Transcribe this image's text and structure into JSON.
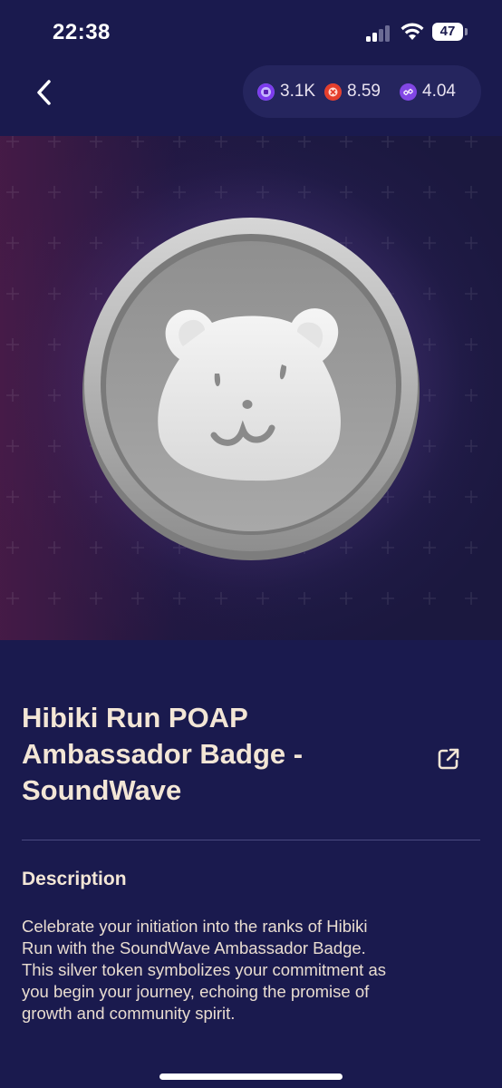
{
  "status_bar": {
    "time": "22:38",
    "battery": "47",
    "icons": [
      "cellular-signal-icon",
      "wifi-icon",
      "battery-icon"
    ]
  },
  "nav": {
    "back_icon": "chevron-left-icon",
    "balances": [
      {
        "icon": "hibiki-token-icon",
        "color": "#8b5cf6",
        "value": "3.1K"
      },
      {
        "icon": "red-token-icon",
        "color": "#f04b3a",
        "value": "8.59"
      },
      {
        "icon": "polygon-icon",
        "color": "#8247e5",
        "value": "4.04"
      }
    ]
  },
  "artwork": {
    "description_icon": "hamster-silver-coin-badge"
  },
  "title_lines": [
    "Hibiki Run POAP",
    "Ambassador Badge -",
    "SoundWave"
  ],
  "external_link_icon": "external-link-icon",
  "description": {
    "heading": "Description",
    "lines": [
      "Celebrate your initiation into the ranks of Hibiki",
      "Run with the SoundWave Ambassador Badge.",
      "This silver token symbolizes your commitment as",
      "you begin your journey, echoing the promise of",
      "growth and community spirit."
    ]
  },
  "colors": {
    "background": "#1a1a4e",
    "text": "#f3e6d6",
    "pill": "#25255e"
  }
}
